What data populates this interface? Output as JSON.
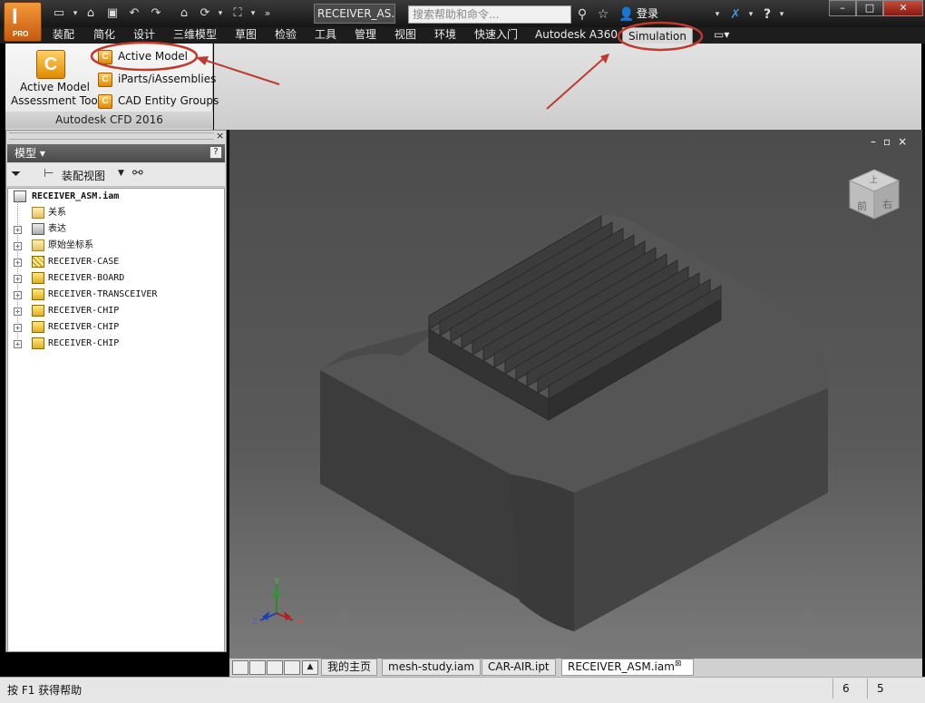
{
  "app": {
    "logo_letter": "I",
    "logo_sub": "PRO"
  },
  "titlebar": {
    "document": "RECEIVER_AS...",
    "search_placeholder": "搜索帮助和命令...",
    "login": "登录"
  },
  "ribbon_tabs": [
    "装配",
    "简化",
    "设计",
    "三维模型",
    "草图",
    "检验",
    "工具",
    "管理",
    "视图",
    "环境",
    "快速入门",
    "Autodesk A360",
    "Simulation"
  ],
  "ribbon_panel": {
    "big_button": {
      "line1": "Active Model",
      "line2": "Assessment Tool"
    },
    "items": [
      "Active Model",
      "iParts/iAssemblies",
      "CAD Entity Groups"
    ],
    "footer": "Autodesk CFD 2016"
  },
  "browser": {
    "title": "模型 ▾",
    "view_label": "装配视图",
    "root": "RECEIVER_ASM.iam",
    "nodes": [
      {
        "label": "关系",
        "expandable": false,
        "icon": "folder"
      },
      {
        "label": "表达",
        "expandable": true,
        "icon": "representation"
      },
      {
        "label": "原始坐标系",
        "expandable": true,
        "icon": "folder"
      },
      {
        "label": "RECEIVER-CASE",
        "expandable": true,
        "icon": "part"
      },
      {
        "label": "RECEIVER-BOARD",
        "expandable": true,
        "icon": "part"
      },
      {
        "label": "RECEIVER-TRANSCEIVER",
        "expandable": true,
        "icon": "part"
      },
      {
        "label": "RECEIVER-CHIP",
        "expandable": true,
        "icon": "part"
      },
      {
        "label": "RECEIVER-CHIP",
        "expandable": true,
        "icon": "part"
      },
      {
        "label": "RECEIVER-CHIP",
        "expandable": true,
        "icon": "part"
      }
    ]
  },
  "viewport": {
    "cube_top": "上",
    "cube_front": "前",
    "cube_right": "右",
    "axis_x": "X",
    "axis_y": "Y",
    "axis_z": "Z"
  },
  "doc_tabs": [
    "我的主页",
    "mesh-study.iam",
    "CAR-AIR.ipt",
    "RECEIVER_ASM.iam"
  ],
  "status": {
    "help": "按 F1 获得帮助",
    "num1": "6",
    "num2": "5"
  },
  "colors": {
    "annotation": "#c0392b",
    "accent": "#e07a1a"
  }
}
